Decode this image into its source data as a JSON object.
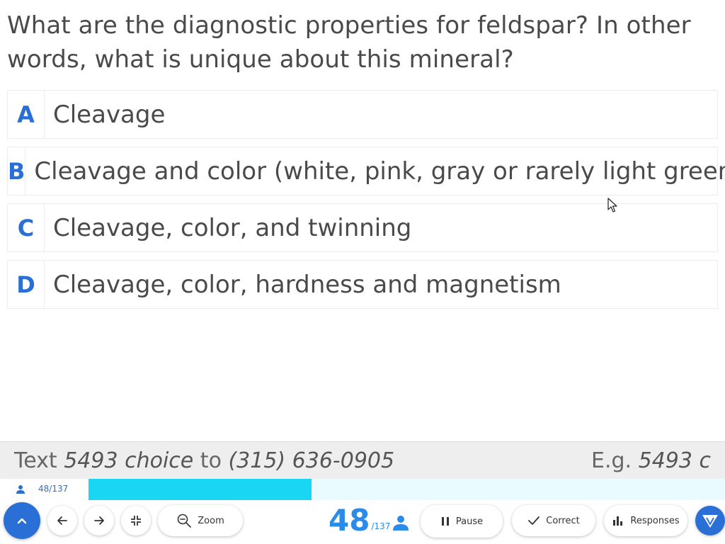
{
  "question": {
    "text": "What are the diagnostic properties for feldspar?  In other words, what is unique about this mineral?"
  },
  "choices": [
    {
      "letter": "A",
      "text": "Cleavage"
    },
    {
      "letter": "B",
      "text": "Cleavage and color (white, pink, gray or rarely light green)"
    },
    {
      "letter": "C",
      "text": "Cleavage, color, and twinning"
    },
    {
      "letter": "D",
      "text": "Cleavage, color, hardness and magnetism"
    }
  ],
  "sms": {
    "prefix": "Text ",
    "code": "5493 choice",
    "middle": " to ",
    "phone": "(315) 636-0905",
    "example_prefix": "E.g. ",
    "example_code": "5493 c"
  },
  "progress": {
    "count": "48/137",
    "fraction": 0.35
  },
  "toolbar": {
    "zoom_label": "Zoom",
    "slide_number": "48",
    "slide_total": "/137",
    "pause_label": "Pause",
    "correct_label": "Correct",
    "responses_label": "Responses"
  },
  "colors": {
    "accent": "#2a6fd6",
    "progress_fill": "#19d6f2",
    "progress_track": "#e9fbfe"
  }
}
